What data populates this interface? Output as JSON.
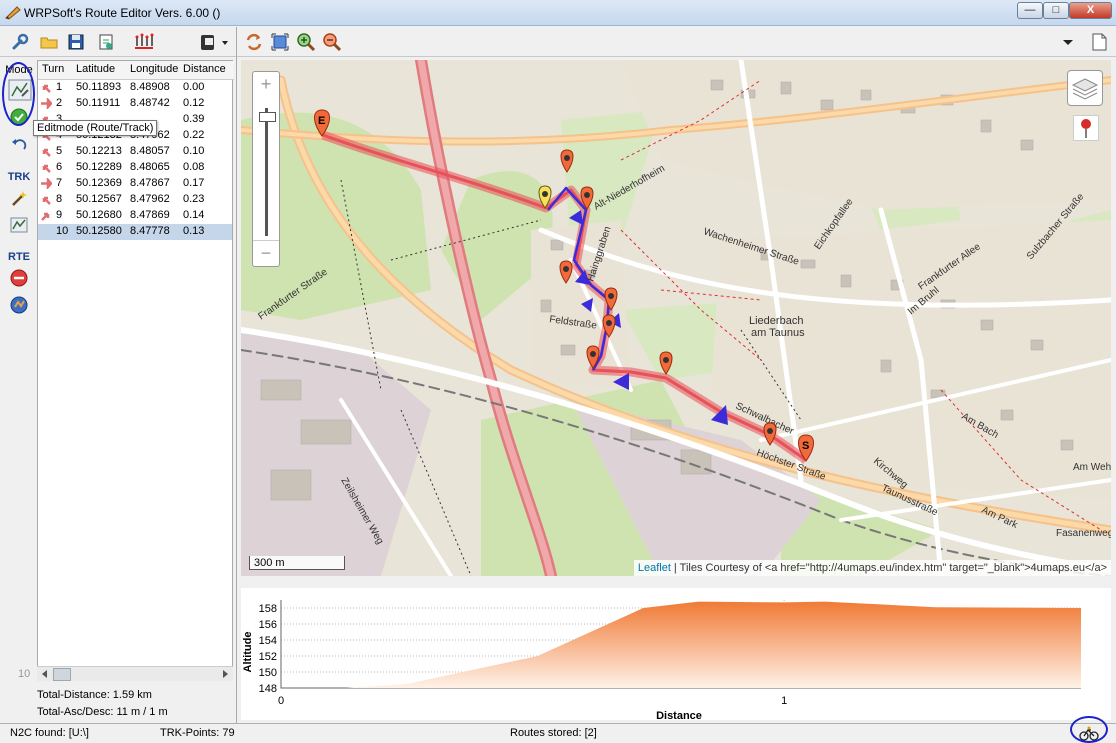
{
  "window": {
    "title": "WRPSoft's Route Editor Vers. 6.00 ()",
    "controls": {
      "minimize": "—",
      "maximize": "□",
      "close": "X"
    }
  },
  "toolbar": {
    "left_icons": [
      "wrench-icon",
      "open-folder-icon",
      "save-icon",
      "export-icon",
      "route-points-icon",
      "device-icon"
    ],
    "right_icons": [
      "refresh-icon",
      "fit-icon",
      "zoom-in-icon",
      "zoom-out-icon"
    ]
  },
  "sidebar": {
    "mode_label": "Mode",
    "trk_label": "TRK",
    "rte_label": "RTE",
    "tooltip": "Editmode (Route/Track)"
  },
  "table": {
    "columns": [
      "Turn",
      "Latitude",
      "Longitude",
      "Distance"
    ],
    "rows": [
      {
        "turn": "1",
        "lat": "50.11893",
        "lon": "8.48908",
        "dist": "0.00",
        "dir": "slight-left"
      },
      {
        "turn": "2",
        "lat": "50.11911",
        "lon": "8.48742",
        "dist": "0.12",
        "dir": "right"
      },
      {
        "turn": "3",
        "lat": "",
        "lon": "",
        "dist": "0.39",
        "dir": "slight-left"
      },
      {
        "turn": "4",
        "lat": "50.12132",
        "lon": "8.47962",
        "dist": "0.22",
        "dir": "slight-left"
      },
      {
        "turn": "5",
        "lat": "50.12213",
        "lon": "8.48057",
        "dist": "0.10",
        "dir": "slight-left"
      },
      {
        "turn": "6",
        "lat": "50.12289",
        "lon": "8.48065",
        "dist": "0.08",
        "dir": "slight-left"
      },
      {
        "turn": "7",
        "lat": "50.12369",
        "lon": "8.47867",
        "dist": "0.17",
        "dir": "right"
      },
      {
        "turn": "8",
        "lat": "50.12567",
        "lon": "8.47962",
        "dist": "0.23",
        "dir": "slight-left"
      },
      {
        "turn": "9",
        "lat": "50.12680",
        "lon": "8.47869",
        "dist": "0.14",
        "dir": "slight-right"
      },
      {
        "turn": "10",
        "lat": "50.12580",
        "lon": "8.47778",
        "dist": "0.13",
        "dir": "none"
      }
    ],
    "selected_row": 10,
    "row_count": "10"
  },
  "summary": {
    "distance": "Total-Distance: 1.59 km",
    "ascdesc": "Total-Asc/Desc: 11 m / 1 m"
  },
  "map": {
    "zoom_in": "+",
    "zoom_out": "−",
    "scale": "300 m",
    "attribution_link": "Leaflet",
    "attribution_text": " | Tiles Courtesy of <a href=\"http://4umaps.eu/index.htm\" target=\"_blank\">4umaps.eu</a>",
    "labels": [
      {
        "text": "Liederbach",
        "cls": "town"
      },
      {
        "text": "am Taunus",
        "cls": "town"
      },
      {
        "text": "Feldstraße",
        "cls": "street"
      },
      {
        "text": "Hainggraben",
        "cls": "street"
      },
      {
        "text": "Alt-Niederhofheim",
        "cls": "street"
      },
      {
        "text": "Wachenheimer Straße",
        "cls": "street"
      },
      {
        "text": "Frankfurter Straße",
        "cls": "street"
      },
      {
        "text": "Zeilsheimer Weg",
        "cls": "street"
      },
      {
        "text": "Höchster Straße",
        "cls": "street"
      },
      {
        "text": "Taunusstraße",
        "cls": "street"
      },
      {
        "text": "Am Bach",
        "cls": "street"
      },
      {
        "text": "Am Park",
        "cls": "street"
      },
      {
        "text": "Kirchweg",
        "cls": "street"
      },
      {
        "text": "Sulzbacher Straße",
        "cls": "street"
      },
      {
        "text": "Eichkopfallee",
        "cls": "street"
      },
      {
        "text": "Fasanenweg",
        "cls": "street"
      },
      {
        "text": "Am Wehr",
        "cls": "street"
      },
      {
        "text": "Schwalbacher",
        "cls": "street"
      },
      {
        "text": "Im Bruhl",
        "cls": "street"
      },
      {
        "text": "Frankfurter Allee",
        "cls": "street"
      }
    ],
    "start_marker": "S",
    "end_marker": "E"
  },
  "elevation": {
    "ylabel": "Altitude",
    "xlabel": "Distance",
    "yticks": [
      "158",
      "156",
      "154",
      "152",
      "150",
      "148"
    ],
    "xticks": [
      "0",
      "1"
    ]
  },
  "chart_data": {
    "type": "area",
    "title": "",
    "xlabel": "Distance",
    "ylabel": "Altitude",
    "x": [
      0,
      0.13,
      0.25,
      0.51,
      0.72,
      0.83,
      1.0,
      1.08,
      1.3,
      1.59
    ],
    "y": [
      148,
      148,
      148.5,
      152,
      158,
      158.8,
      158.7,
      158.8,
      158.1,
      158
    ],
    "xlim": [
      0,
      1.59
    ],
    "ylim": [
      148,
      159
    ],
    "grid": true,
    "fill_color": "#f07a36"
  },
  "statusbar": {
    "n2c": "N2C found: [U:\\]",
    "trk": "TRK-Points: 79",
    "routes": "Routes stored: [2]"
  },
  "colors": {
    "accent": "#1b23c9",
    "route": "#e8505a",
    "arrow": "#3b2bd8"
  }
}
